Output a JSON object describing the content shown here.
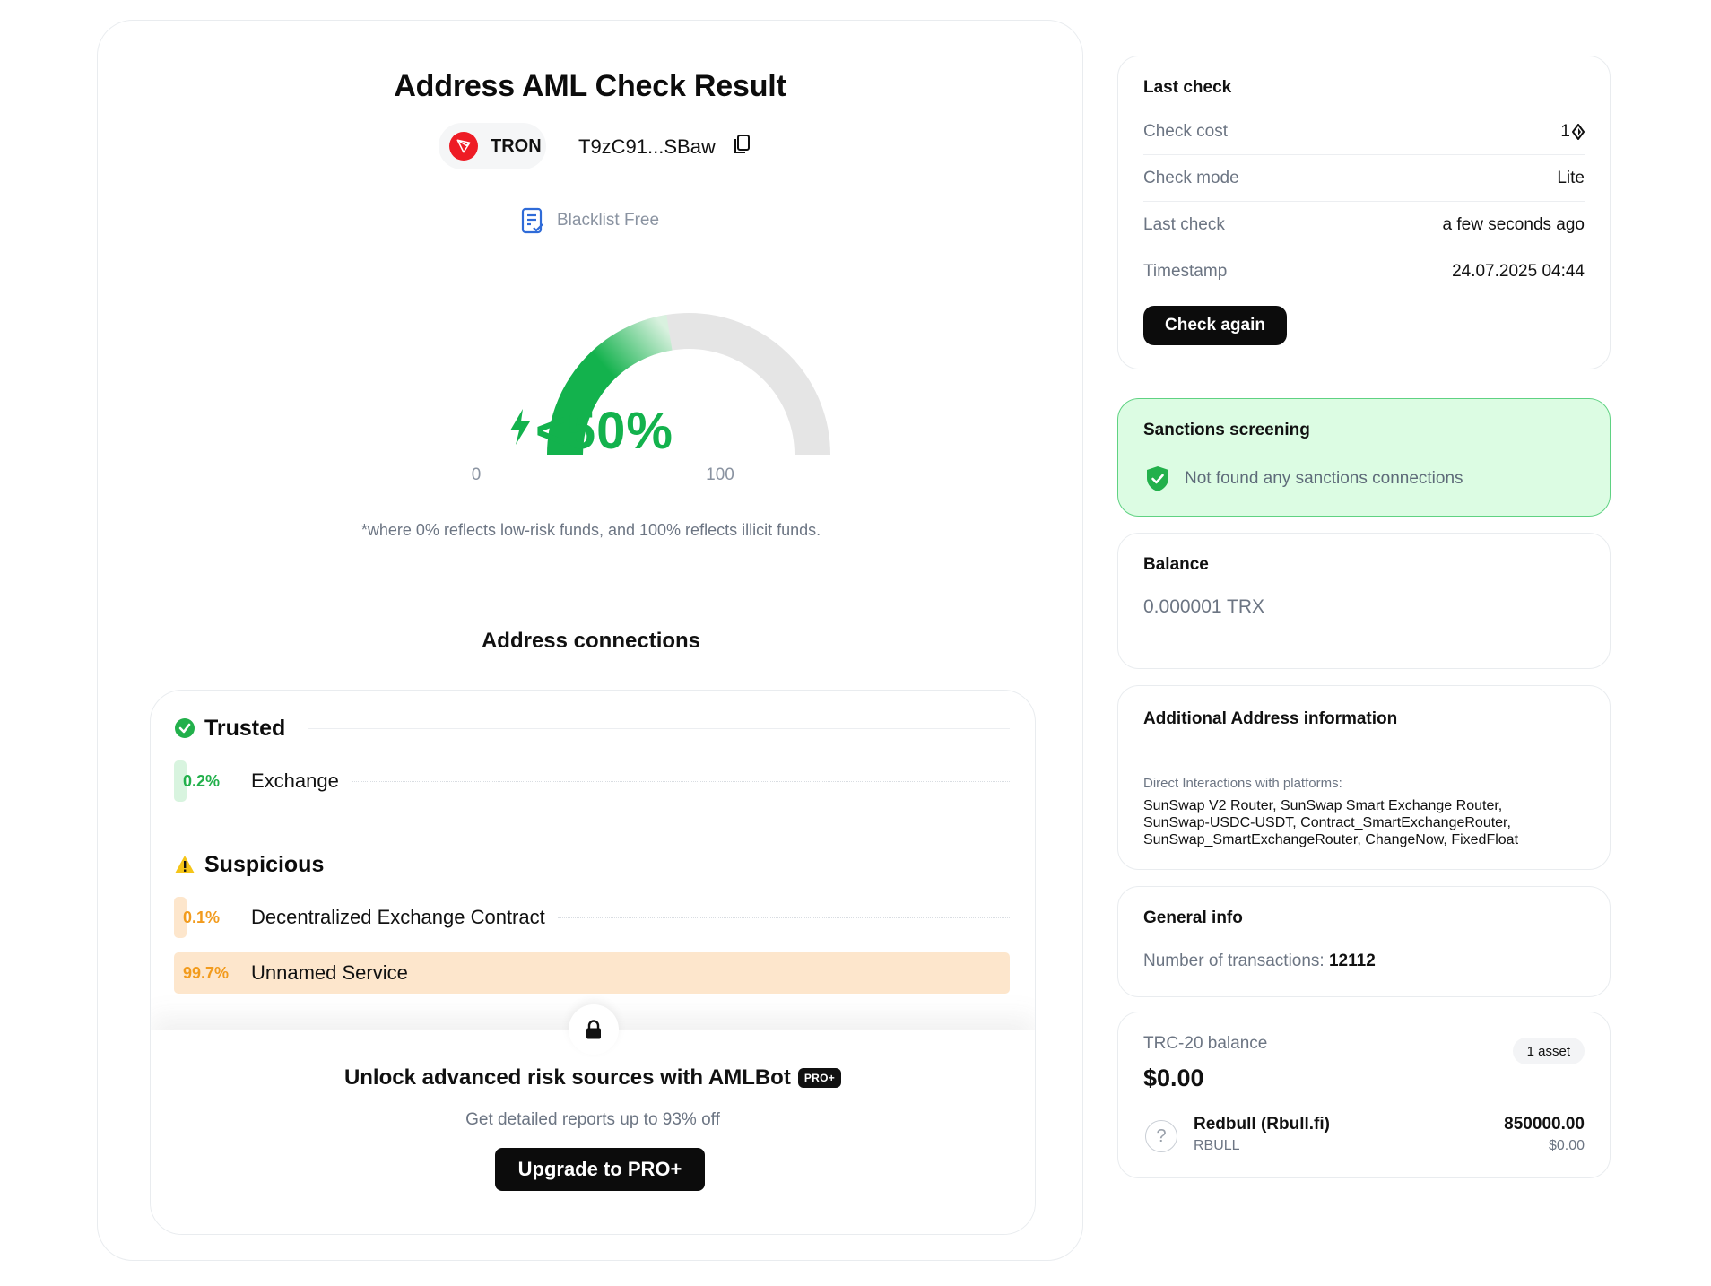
{
  "main": {
    "title": "Address AML Check Result",
    "network": "TRON",
    "address": "T9zC91...SBaw",
    "blacklist_status": "Blacklist Free",
    "risk_score": {
      "label": "<50%",
      "fill_fraction": 0.45,
      "min_label": "0",
      "max_label": "100",
      "note": "*where 0% reflects low-risk funds, and 100% reflects illicit funds."
    },
    "colors": {
      "accent_green": "#13b24d",
      "warning_orange": "#f29b1d",
      "highlight_bg": "#fde6cc"
    }
  },
  "connections": {
    "title": "Address connections",
    "categories": [
      {
        "label": "Trusted",
        "icon": "check-circle-icon",
        "items": [
          {
            "pct": "0.2%",
            "name": "Exchange"
          }
        ]
      },
      {
        "label": "Suspicious",
        "icon": "warning-triangle-icon",
        "items": [
          {
            "pct": "0.1%",
            "name": "Decentralized Exchange Contract"
          },
          {
            "pct": "99.7%",
            "name": "Unnamed Service"
          }
        ]
      }
    ]
  },
  "unlock": {
    "title": "Unlock advanced risk sources with AMLBot",
    "badge": "PRO+",
    "subtitle": "Get detailed reports up to 93% off",
    "button": "Upgrade to PRO+"
  },
  "last_check": {
    "title": "Last check",
    "rows": [
      {
        "key": "Check cost",
        "value": "1"
      },
      {
        "key": "Check mode",
        "value": "Lite"
      },
      {
        "key": "Last check",
        "value": "a few seconds ago"
      },
      {
        "key": "Timestamp",
        "value": "24.07.2025 04:44"
      }
    ],
    "button": "Check again"
  },
  "sanctions": {
    "title": "Sanctions screening",
    "status": "Not found any sanctions connections"
  },
  "balance": {
    "title": "Balance",
    "value": "0.000001 TRX"
  },
  "additional": {
    "title": "Additional Address information",
    "label": "Direct Interactions with platforms:",
    "platforms": "SunSwap V2 Router, SunSwap Smart Exchange Router, SunSwap-USDC-USDT, Contract_SmartExchangeRouter, SunSwap_SmartExchangeRouter, ChangeNow, FixedFloat"
  },
  "general": {
    "title": "General info",
    "tx_label": "Number of transactions:",
    "tx_count": "12112"
  },
  "trc20": {
    "title": "TRC-20 balance",
    "asset_count": "1 asset",
    "total": "$0.00",
    "tokens": [
      {
        "name": "Redbull (Rbull.fi)",
        "symbol": "RBULL",
        "amount": "850000.00",
        "usd": "$0.00"
      }
    ]
  }
}
